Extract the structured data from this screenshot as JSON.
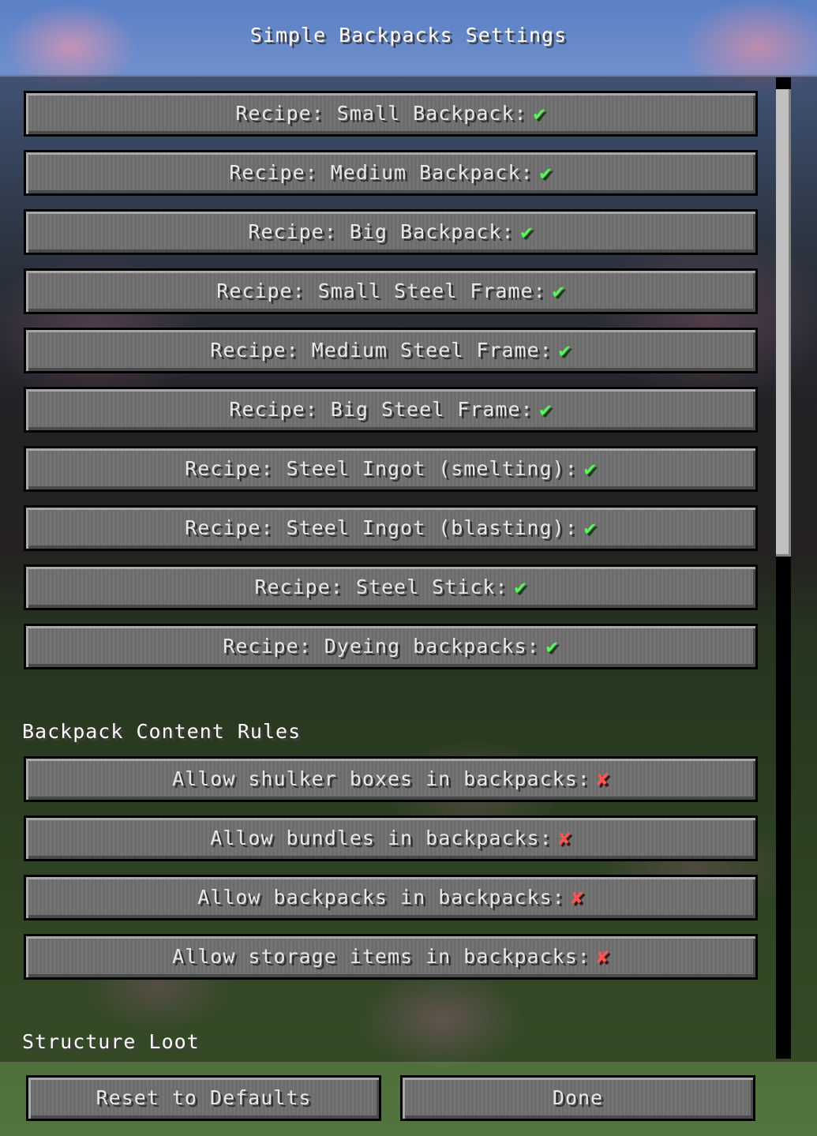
{
  "title": "Simple Backpacks Settings",
  "check_on": "✔",
  "check_off": "✘",
  "recipes": [
    "Recipe: Small Backpack:",
    "Recipe: Medium Backpack:",
    "Recipe: Big Backpack:",
    "Recipe: Small Steel Frame:",
    "Recipe: Medium Steel Frame:",
    "Recipe: Big Steel Frame:",
    "Recipe: Steel Ingot (smelting):",
    "Recipe: Steel Ingot (blasting):",
    "Recipe: Steel Stick:",
    "Recipe: Dyeing backpacks:"
  ],
  "content_rules": {
    "heading": "Backpack Content Rules",
    "items": [
      "Allow shulker boxes in backpacks:",
      "Allow bundles in backpacks:",
      "Allow backpacks in backpacks:",
      "Allow storage items in backpacks:"
    ]
  },
  "structure_loot": {
    "heading": "Structure Loot"
  },
  "footer": {
    "reset_label": "Reset to Defaults",
    "done_label": "Done"
  },
  "colors": {
    "enabled": "#55ff55",
    "disabled": "#ff5555",
    "button_face": "#6f6f6f"
  }
}
